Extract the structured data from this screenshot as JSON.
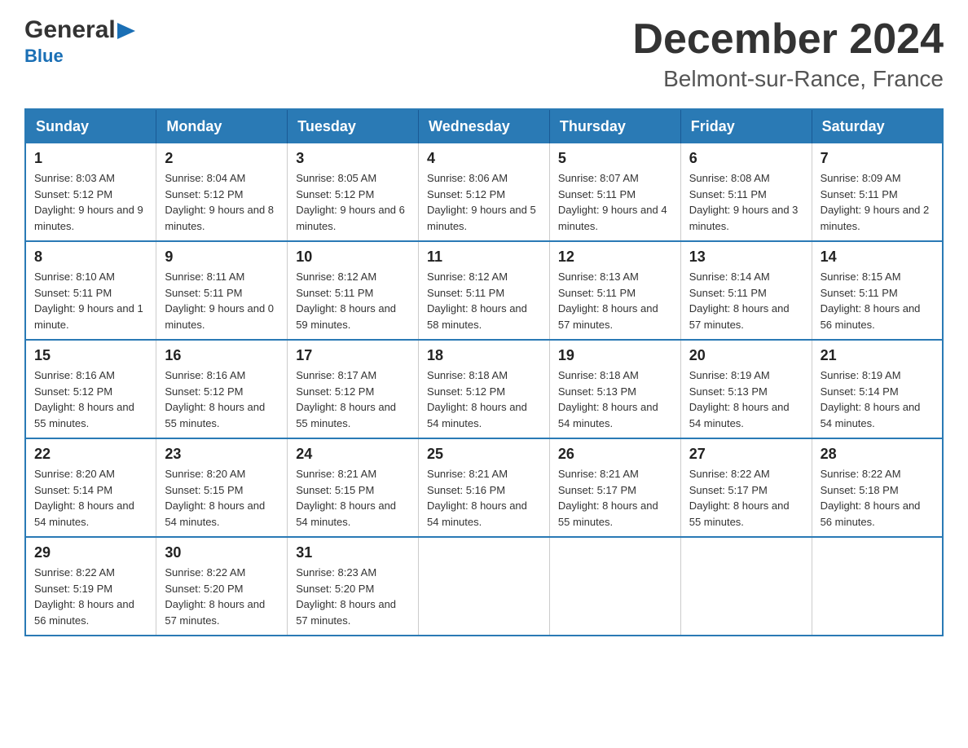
{
  "header": {
    "logo_general": "General",
    "logo_blue": "Blue",
    "month_title": "December 2024",
    "location": "Belmont-sur-Rance, France"
  },
  "days_of_week": [
    "Sunday",
    "Monday",
    "Tuesday",
    "Wednesday",
    "Thursday",
    "Friday",
    "Saturday"
  ],
  "weeks": [
    [
      {
        "day": "1",
        "sunrise": "Sunrise: 8:03 AM",
        "sunset": "Sunset: 5:12 PM",
        "daylight": "Daylight: 9 hours and 9 minutes."
      },
      {
        "day": "2",
        "sunrise": "Sunrise: 8:04 AM",
        "sunset": "Sunset: 5:12 PM",
        "daylight": "Daylight: 9 hours and 8 minutes."
      },
      {
        "day": "3",
        "sunrise": "Sunrise: 8:05 AM",
        "sunset": "Sunset: 5:12 PM",
        "daylight": "Daylight: 9 hours and 6 minutes."
      },
      {
        "day": "4",
        "sunrise": "Sunrise: 8:06 AM",
        "sunset": "Sunset: 5:12 PM",
        "daylight": "Daylight: 9 hours and 5 minutes."
      },
      {
        "day": "5",
        "sunrise": "Sunrise: 8:07 AM",
        "sunset": "Sunset: 5:11 PM",
        "daylight": "Daylight: 9 hours and 4 minutes."
      },
      {
        "day": "6",
        "sunrise": "Sunrise: 8:08 AM",
        "sunset": "Sunset: 5:11 PM",
        "daylight": "Daylight: 9 hours and 3 minutes."
      },
      {
        "day": "7",
        "sunrise": "Sunrise: 8:09 AM",
        "sunset": "Sunset: 5:11 PM",
        "daylight": "Daylight: 9 hours and 2 minutes."
      }
    ],
    [
      {
        "day": "8",
        "sunrise": "Sunrise: 8:10 AM",
        "sunset": "Sunset: 5:11 PM",
        "daylight": "Daylight: 9 hours and 1 minute."
      },
      {
        "day": "9",
        "sunrise": "Sunrise: 8:11 AM",
        "sunset": "Sunset: 5:11 PM",
        "daylight": "Daylight: 9 hours and 0 minutes."
      },
      {
        "day": "10",
        "sunrise": "Sunrise: 8:12 AM",
        "sunset": "Sunset: 5:11 PM",
        "daylight": "Daylight: 8 hours and 59 minutes."
      },
      {
        "day": "11",
        "sunrise": "Sunrise: 8:12 AM",
        "sunset": "Sunset: 5:11 PM",
        "daylight": "Daylight: 8 hours and 58 minutes."
      },
      {
        "day": "12",
        "sunrise": "Sunrise: 8:13 AM",
        "sunset": "Sunset: 5:11 PM",
        "daylight": "Daylight: 8 hours and 57 minutes."
      },
      {
        "day": "13",
        "sunrise": "Sunrise: 8:14 AM",
        "sunset": "Sunset: 5:11 PM",
        "daylight": "Daylight: 8 hours and 57 minutes."
      },
      {
        "day": "14",
        "sunrise": "Sunrise: 8:15 AM",
        "sunset": "Sunset: 5:11 PM",
        "daylight": "Daylight: 8 hours and 56 minutes."
      }
    ],
    [
      {
        "day": "15",
        "sunrise": "Sunrise: 8:16 AM",
        "sunset": "Sunset: 5:12 PM",
        "daylight": "Daylight: 8 hours and 55 minutes."
      },
      {
        "day": "16",
        "sunrise": "Sunrise: 8:16 AM",
        "sunset": "Sunset: 5:12 PM",
        "daylight": "Daylight: 8 hours and 55 minutes."
      },
      {
        "day": "17",
        "sunrise": "Sunrise: 8:17 AM",
        "sunset": "Sunset: 5:12 PM",
        "daylight": "Daylight: 8 hours and 55 minutes."
      },
      {
        "day": "18",
        "sunrise": "Sunrise: 8:18 AM",
        "sunset": "Sunset: 5:12 PM",
        "daylight": "Daylight: 8 hours and 54 minutes."
      },
      {
        "day": "19",
        "sunrise": "Sunrise: 8:18 AM",
        "sunset": "Sunset: 5:13 PM",
        "daylight": "Daylight: 8 hours and 54 minutes."
      },
      {
        "day": "20",
        "sunrise": "Sunrise: 8:19 AM",
        "sunset": "Sunset: 5:13 PM",
        "daylight": "Daylight: 8 hours and 54 minutes."
      },
      {
        "day": "21",
        "sunrise": "Sunrise: 8:19 AM",
        "sunset": "Sunset: 5:14 PM",
        "daylight": "Daylight: 8 hours and 54 minutes."
      }
    ],
    [
      {
        "day": "22",
        "sunrise": "Sunrise: 8:20 AM",
        "sunset": "Sunset: 5:14 PM",
        "daylight": "Daylight: 8 hours and 54 minutes."
      },
      {
        "day": "23",
        "sunrise": "Sunrise: 8:20 AM",
        "sunset": "Sunset: 5:15 PM",
        "daylight": "Daylight: 8 hours and 54 minutes."
      },
      {
        "day": "24",
        "sunrise": "Sunrise: 8:21 AM",
        "sunset": "Sunset: 5:15 PM",
        "daylight": "Daylight: 8 hours and 54 minutes."
      },
      {
        "day": "25",
        "sunrise": "Sunrise: 8:21 AM",
        "sunset": "Sunset: 5:16 PM",
        "daylight": "Daylight: 8 hours and 54 minutes."
      },
      {
        "day": "26",
        "sunrise": "Sunrise: 8:21 AM",
        "sunset": "Sunset: 5:17 PM",
        "daylight": "Daylight: 8 hours and 55 minutes."
      },
      {
        "day": "27",
        "sunrise": "Sunrise: 8:22 AM",
        "sunset": "Sunset: 5:17 PM",
        "daylight": "Daylight: 8 hours and 55 minutes."
      },
      {
        "day": "28",
        "sunrise": "Sunrise: 8:22 AM",
        "sunset": "Sunset: 5:18 PM",
        "daylight": "Daylight: 8 hours and 56 minutes."
      }
    ],
    [
      {
        "day": "29",
        "sunrise": "Sunrise: 8:22 AM",
        "sunset": "Sunset: 5:19 PM",
        "daylight": "Daylight: 8 hours and 56 minutes."
      },
      {
        "day": "30",
        "sunrise": "Sunrise: 8:22 AM",
        "sunset": "Sunset: 5:20 PM",
        "daylight": "Daylight: 8 hours and 57 minutes."
      },
      {
        "day": "31",
        "sunrise": "Sunrise: 8:23 AM",
        "sunset": "Sunset: 5:20 PM",
        "daylight": "Daylight: 8 hours and 57 minutes."
      },
      null,
      null,
      null,
      null
    ]
  ]
}
